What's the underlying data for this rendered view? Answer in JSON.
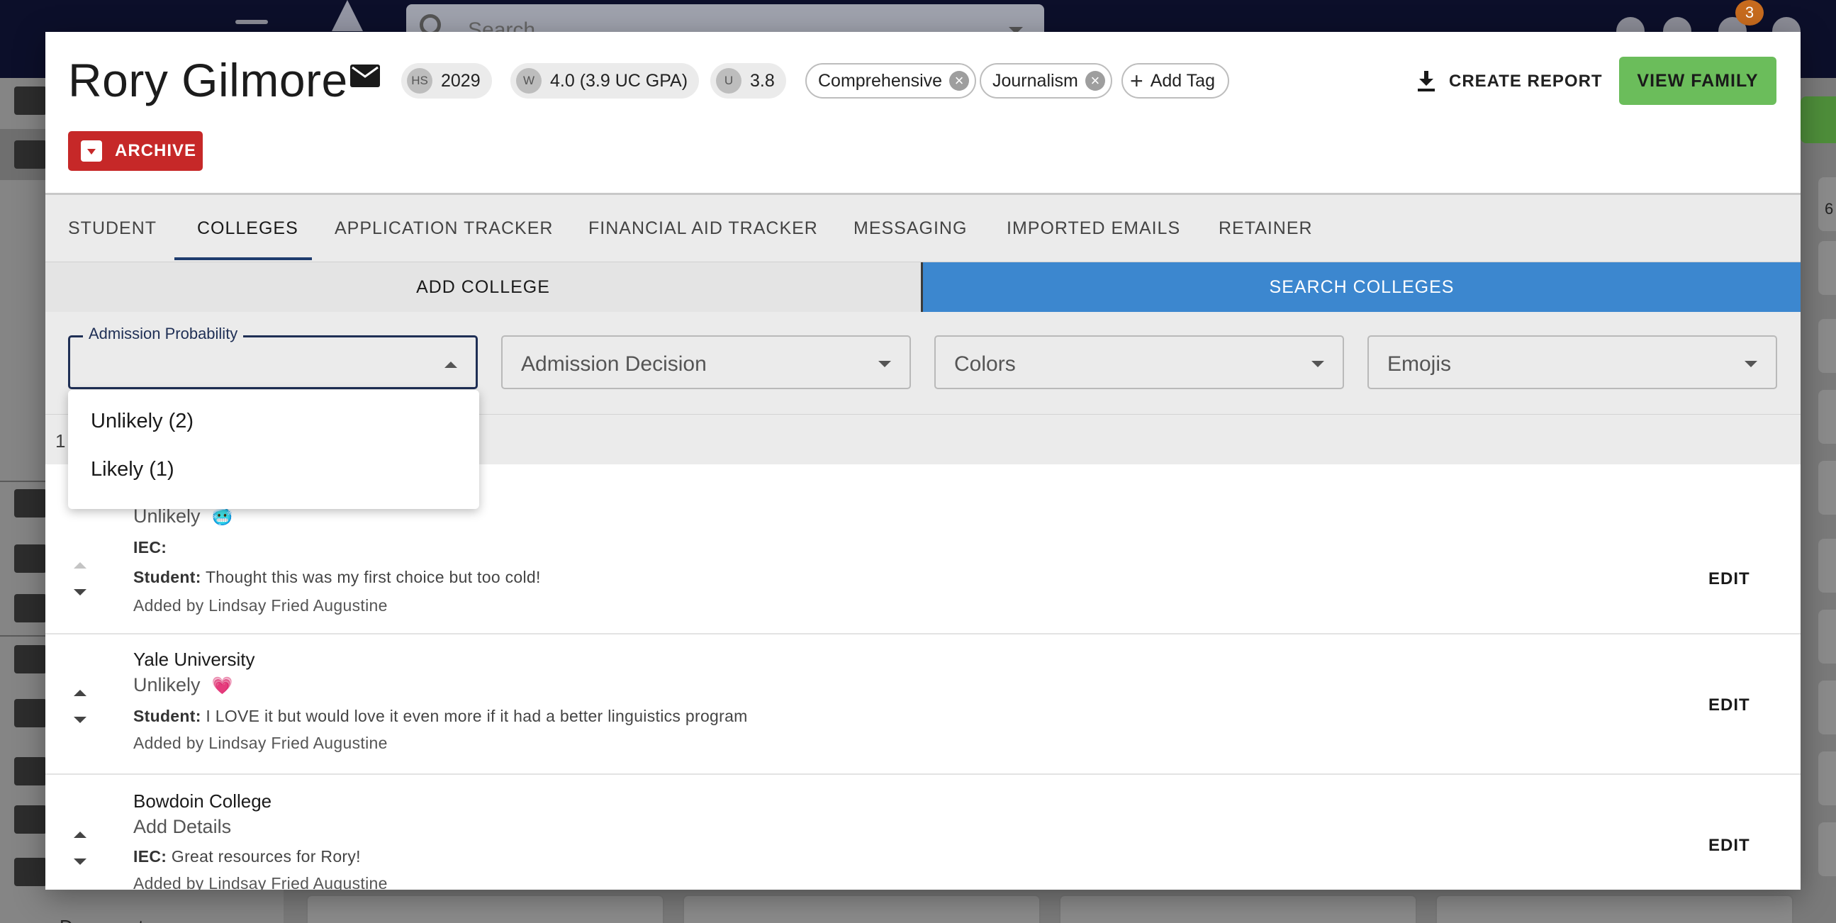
{
  "background": {
    "search_placeholder": "Search",
    "notification_count": "3",
    "sidebar_documents_label": "Documents",
    "right_edge_number": "6"
  },
  "header": {
    "student_name": "Rory Gilmore",
    "chips": [
      {
        "abbr": "HS",
        "value": "2029"
      },
      {
        "abbr": "W",
        "value": "4.0 (3.9 UC GPA)"
      },
      {
        "abbr": "U",
        "value": "3.8"
      }
    ],
    "tags": [
      "Comprehensive",
      "Journalism"
    ],
    "add_tag_label": "Add Tag",
    "create_report_label": "CREATE REPORT",
    "view_family_label": "VIEW FAMILY",
    "archive_label": "ARCHIVE"
  },
  "tabs": [
    {
      "label": "STUDENT",
      "active": false
    },
    {
      "label": "COLLEGES",
      "active": true
    },
    {
      "label": "APPLICATION TRACKER",
      "active": false
    },
    {
      "label": "FINANCIAL AID TRACKER",
      "active": false
    },
    {
      "label": "MESSAGING",
      "active": false
    },
    {
      "label": "IMPORTED EMAILS",
      "active": false
    },
    {
      "label": "RETAINER",
      "active": false
    }
  ],
  "subbar": {
    "add_college_label": "ADD COLLEGE",
    "search_colleges_label": "SEARCH COLLEGES"
  },
  "filters": {
    "admission_probability_label": "Admission Probability",
    "admission_decision_placeholder": "Admission Decision",
    "colors_placeholder": "Colors",
    "emojis_placeholder": "Emojis"
  },
  "dropdown_options": [
    "Unlikely (2)",
    "Likely (1)"
  ],
  "count_text": "1",
  "colleges": [
    {
      "name": "",
      "probability": "Unlikely",
      "emoji": "🥶",
      "iec_label": "IEC:",
      "iec_text": "",
      "student_label": "Student:",
      "student_text": "Thought this was my first choice but too cold!",
      "added_by": "Added by Lindsay Fried Augustine",
      "edit_label": "EDIT"
    },
    {
      "name": "Yale University",
      "probability": "Unlikely",
      "emoji": "💗",
      "student_label": "Student:",
      "student_text": "I LOVE it but would love it even more if it had a better linguistics program",
      "added_by": "Added by Lindsay Fried Augustine",
      "edit_label": "EDIT"
    },
    {
      "name": "Bowdoin College",
      "probability": "Add Details",
      "iec_label": "IEC:",
      "iec_text": "Great resources for Rory!",
      "added_by": "Added by Lindsay Fried Augustine",
      "edit_label": "EDIT"
    }
  ],
  "colors": {
    "accent_blue": "#3c87cf",
    "view_family_green": "#6bbd5b",
    "archive_red": "#c62828",
    "topbar_navy": "#0c0f2a",
    "tab_indicator": "#1f3c6e"
  }
}
